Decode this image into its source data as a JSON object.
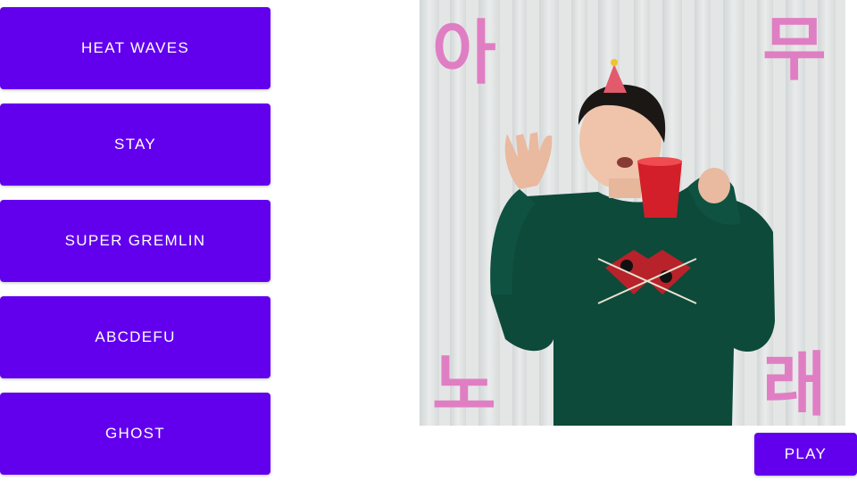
{
  "songs": [
    {
      "label": "HEAT WAVES"
    },
    {
      "label": "STAY"
    },
    {
      "label": "SUPER GREMLIN"
    },
    {
      "label": "ABCDEFU"
    },
    {
      "label": "GHOST"
    }
  ],
  "album": {
    "corner_text": {
      "top_left": "아",
      "top_right": "무",
      "bottom_left": "노",
      "bottom_right": "래"
    },
    "text_color": "#e07ec4"
  },
  "player": {
    "play_label": "PLAY"
  },
  "colors": {
    "accent": "#6200ee",
    "button_text": "#ffffff"
  }
}
